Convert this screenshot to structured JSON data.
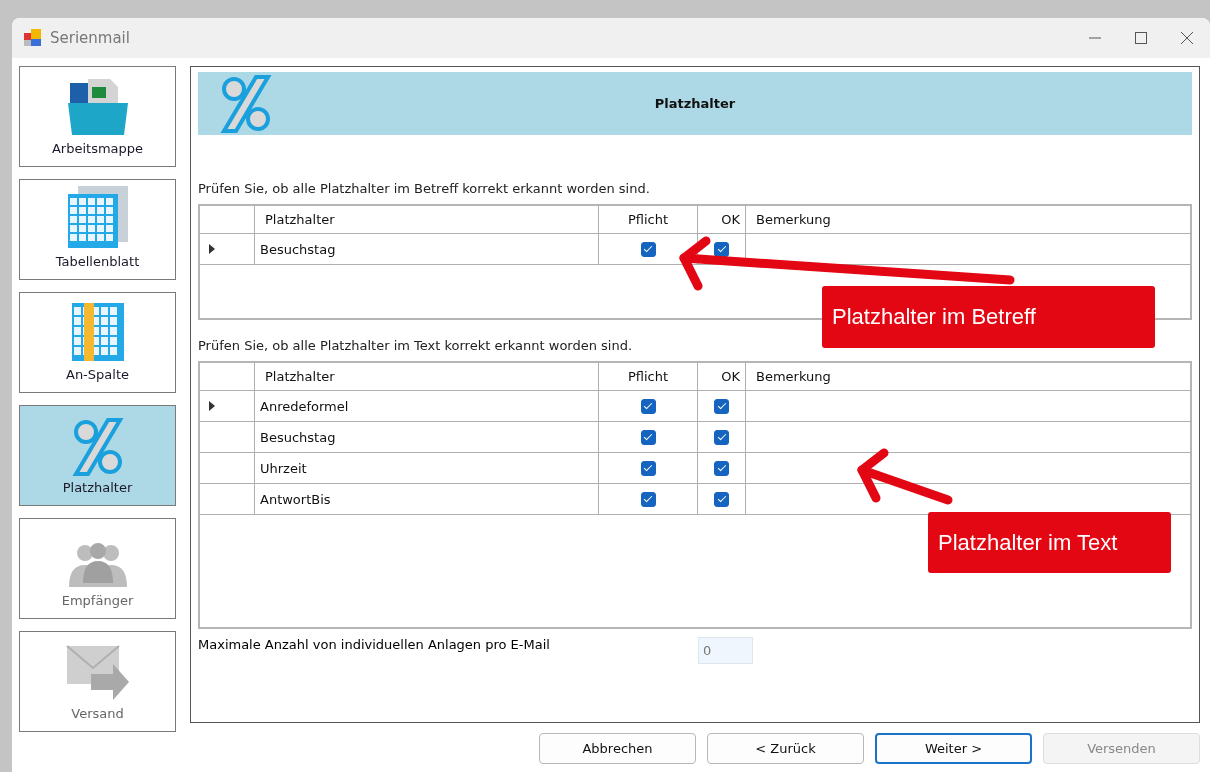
{
  "window": {
    "title": "Serienmail"
  },
  "sidebar": {
    "items": [
      {
        "label": "Arbeitsmappe",
        "kind": "workbook",
        "selected": false,
        "disabled": false
      },
      {
        "label": "Tabellenblatt",
        "kind": "sheet",
        "selected": false,
        "disabled": false
      },
      {
        "label": "An-Spalte",
        "kind": "column",
        "selected": false,
        "disabled": false
      },
      {
        "label": "Platzhalter",
        "kind": "placeholder",
        "selected": true,
        "disabled": false
      },
      {
        "label": "Empfänger",
        "kind": "recipients",
        "selected": false,
        "disabled": true
      },
      {
        "label": "Versand",
        "kind": "send",
        "selected": false,
        "disabled": true
      }
    ]
  },
  "header": {
    "title": "Platzhalter"
  },
  "subject_section": {
    "instruction": "Prüfen Sie, ob alle Platzhalter im Betreff korrekt erkannt worden sind.",
    "table": {
      "columns": [
        "Platzhalter",
        "Pflicht",
        "OK",
        "Bemerkung"
      ],
      "rows": [
        {
          "placeholder": "Besuchstag",
          "required": true,
          "ok": true,
          "current": true
        }
      ]
    }
  },
  "text_section": {
    "instruction": "Prüfen Sie, ob alle Platzhalter im Text korrekt erkannt worden sind.",
    "table": {
      "columns": [
        "Platzhalter",
        "Pflicht",
        "OK",
        "Bemerkung"
      ],
      "rows": [
        {
          "placeholder": "Anredeformel",
          "required": true,
          "ok": true,
          "current": true
        },
        {
          "placeholder": "Besuchstag",
          "required": true,
          "ok": true,
          "current": false
        },
        {
          "placeholder": "Uhrzeit",
          "required": true,
          "ok": true,
          "current": false
        },
        {
          "placeholder": "AntwortBis",
          "required": true,
          "ok": true,
          "current": false
        }
      ]
    }
  },
  "attachments": {
    "label": "Maximale Anzahl von individuellen Anlagen pro E-Mail",
    "value": "0"
  },
  "buttons": [
    {
      "label": "Abbrechen",
      "default": false,
      "disabled": false
    },
    {
      "label": "< Zurück",
      "default": false,
      "disabled": false
    },
    {
      "label": "Weiter >",
      "default": true,
      "disabled": false
    },
    {
      "label": "Versenden",
      "default": false,
      "disabled": true
    }
  ],
  "annotations": [
    {
      "text": "Platzhalter im Betreff"
    },
    {
      "text": "Platzhalter im Text"
    }
  ]
}
